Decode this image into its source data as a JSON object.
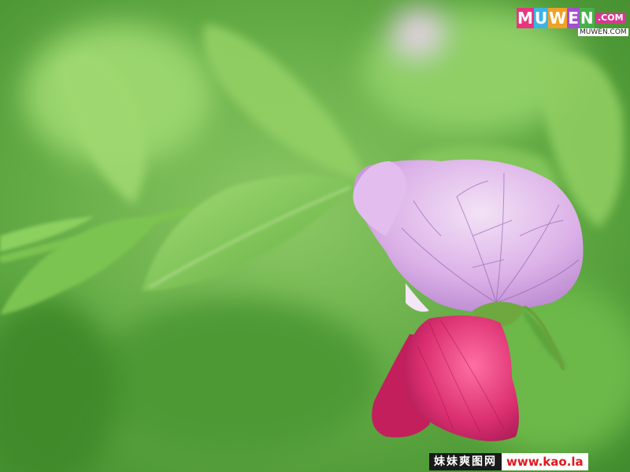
{
  "watermark_top": {
    "letters": [
      "M",
      "U",
      "W",
      "E",
      "N"
    ],
    "letter_colors": [
      "#e8357e",
      "#3db4e6",
      "#f0a126",
      "#a44fd0",
      "#47b04a"
    ],
    "suffix": ".COM",
    "sub": "MUWEN.COM"
  },
  "watermark_bottom": {
    "cn_text": "妹妹爽图网",
    "url": "www.kao.la"
  },
  "colors": {
    "background": "#5fa842",
    "leaf_light": "#8ccf5f",
    "leaf_dark": "#3f8a2c",
    "petal_lilac": "#d6a6e4",
    "petal_magenta": "#d42a6b"
  }
}
